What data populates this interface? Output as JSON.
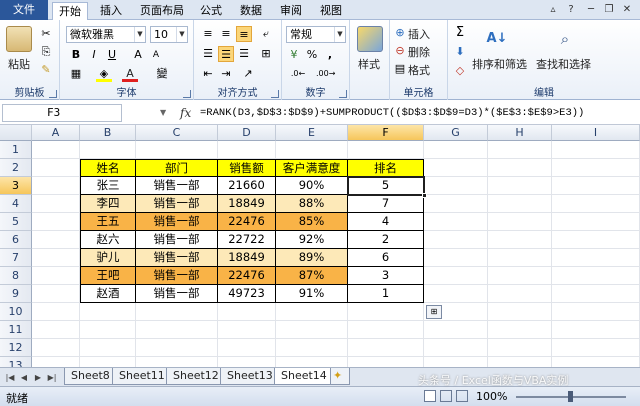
{
  "tabs": [
    "文件",
    "开始",
    "插入",
    "页面布局",
    "公式",
    "数据",
    "审阅",
    "视图"
  ],
  "ribbon": {
    "clipboard": {
      "paste": "粘贴",
      "label": "剪贴板"
    },
    "font": {
      "name": "微软雅黑",
      "size": "10",
      "label": "字体"
    },
    "alignment": {
      "label": "对齐方式"
    },
    "number": {
      "format": "常规",
      "percent": "%",
      "comma": ",",
      "label": "数字"
    },
    "styles": {
      "button": "样式"
    },
    "cells": {
      "insert": "插入",
      "delete": "删除",
      "format": "格式",
      "label": "单元格"
    },
    "editing": {
      "sort": "排序和筛选",
      "find": "查找和选择",
      "label": "编辑"
    }
  },
  "formula_bar": {
    "name_box": "F3",
    "fx": "fx",
    "formula": "=RANK(D3,$D$3:$D$9)+SUMPRODUCT(($D$3:$D$9=D3)*($E$3:$E$9>E3))"
  },
  "columns": [
    "A",
    "B",
    "C",
    "D",
    "E",
    "F",
    "G",
    "H",
    "I"
  ],
  "rows": [
    "1",
    "2",
    "3",
    "4",
    "5",
    "6",
    "7",
    "8",
    "9",
    "10",
    "11",
    "12",
    "13"
  ],
  "table": {
    "headers": [
      "姓名",
      "部门",
      "销售额",
      "客户满意度",
      "排名"
    ],
    "rows": [
      [
        "张三",
        "销售一部",
        "21660",
        "90%",
        "5"
      ],
      [
        "李四",
        "销售一部",
        "18849",
        "88%",
        "7"
      ],
      [
        "王五",
        "销售一部",
        "22476",
        "85%",
        "4"
      ],
      [
        "赵六",
        "销售一部",
        "22722",
        "92%",
        "2"
      ],
      [
        "驴儿",
        "销售一部",
        "18849",
        "89%",
        "6"
      ],
      [
        "王吧",
        "销售一部",
        "22476",
        "87%",
        "3"
      ],
      [
        "赵酒",
        "销售一部",
        "49723",
        "91%",
        "1"
      ]
    ]
  },
  "sheets": [
    "Sheet8",
    "Sheet11",
    "Sheet12",
    "Sheet13",
    "Sheet14"
  ],
  "active_sheet": "Sheet14",
  "status": {
    "ready": "就绪",
    "zoom": "100%"
  },
  "watermark": "头条号 / Excel函数与VBA实例",
  "colors": {
    "header_fill": "#ffff00",
    "highlight_light": "#fde9b8",
    "highlight_dark": "#f9b347",
    "file_tab": "#2b579a"
  }
}
